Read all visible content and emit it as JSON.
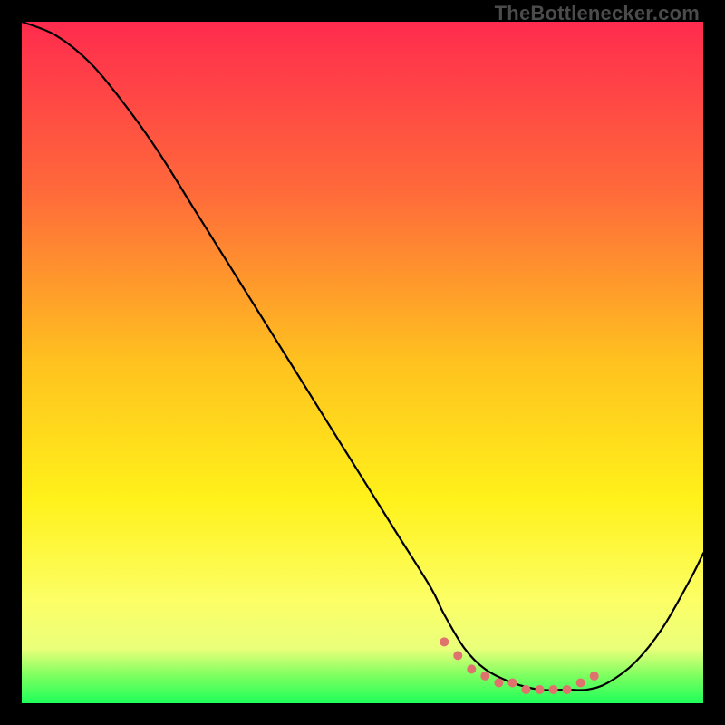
{
  "watermark": "TheBottlenecker.com",
  "chart_data": {
    "type": "line",
    "title": "",
    "xlabel": "",
    "ylabel": "",
    "xlim": [
      0,
      100
    ],
    "ylim": [
      0,
      100
    ],
    "gradient_stops": [
      {
        "offset": 0,
        "color": "#ff2b4e"
      },
      {
        "offset": 25,
        "color": "#ff6a3a"
      },
      {
        "offset": 50,
        "color": "#ffc21f"
      },
      {
        "offset": 70,
        "color": "#fff11a"
      },
      {
        "offset": 85,
        "color": "#fcff66"
      },
      {
        "offset": 92,
        "color": "#eaff7a"
      },
      {
        "offset": 96,
        "color": "#7cff60"
      },
      {
        "offset": 100,
        "color": "#1eff5a"
      }
    ],
    "series": [
      {
        "name": "bottleneck-curve",
        "x": [
          0,
          5,
          10,
          15,
          20,
          25,
          30,
          35,
          40,
          45,
          50,
          55,
          60,
          62,
          65,
          68,
          72,
          76,
          80,
          83,
          86,
          90,
          94,
          98,
          100
        ],
        "y": [
          100,
          98,
          94,
          88,
          81,
          73,
          65,
          57,
          49,
          41,
          33,
          25,
          17,
          13,
          8,
          5,
          3,
          2,
          2,
          2,
          3,
          6,
          11,
          18,
          22
        ]
      }
    ],
    "optimum_markers": {
      "x": [
        62,
        64,
        66,
        68,
        70,
        72,
        74,
        76,
        78,
        80,
        82,
        84
      ],
      "y": [
        9,
        7,
        5,
        4,
        3,
        3,
        2,
        2,
        2,
        2,
        3,
        4
      ],
      "color": "#e0726e",
      "radius": 5
    }
  }
}
